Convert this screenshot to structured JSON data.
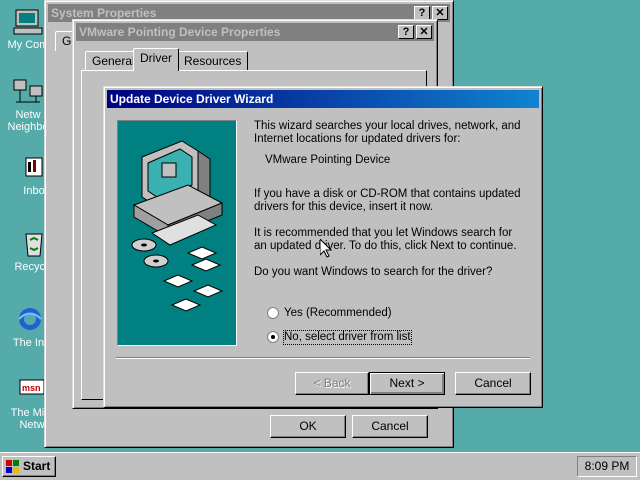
{
  "desktop": {
    "icons": [
      {
        "label": "My Com",
        "icon": "my-computer-icon"
      },
      {
        "label": "Netw",
        "label2": "Neighbo",
        "icon": "network-neighborhood-icon"
      },
      {
        "label": "Inbo",
        "icon": "inbox-icon"
      },
      {
        "label": "Recycle",
        "icon": "recycle-bin-icon"
      },
      {
        "label": "The Int",
        "icon": "internet-explorer-icon"
      },
      {
        "label": "The Micr",
        "label2": "Netw",
        "icon": "msn-icon"
      }
    ]
  },
  "system_properties": {
    "title": "System Properties",
    "tab_partial": "Ge",
    "ok_label": "OK",
    "cancel_label": "Cancel"
  },
  "device_properties": {
    "title": "VMware Pointing Device Properties",
    "tabs": [
      "General",
      "Driver",
      "Resources"
    ]
  },
  "wizard": {
    "title": "Update Device Driver Wizard",
    "para1": "This wizard searches your local drives, network, and Internet locations for updated drivers for:",
    "device_name": "VMware Pointing Device",
    "para2": "If you have a disk or CD-ROM that contains updated drivers for this device, insert it now.",
    "para3": "It is recommended that you let Windows search for an updated driver. To do this, click Next to continue.",
    "question": "Do you want Windows to search for the driver?",
    "options": [
      {
        "label": "Yes (Recommended)",
        "selected": false
      },
      {
        "label": "No, select driver from list",
        "selected": true
      }
    ],
    "back_label": "< Back",
    "next_label": "Next >",
    "cancel_label": "Cancel"
  },
  "taskbar": {
    "start_label": "Start",
    "clock": "8:09 PM"
  }
}
